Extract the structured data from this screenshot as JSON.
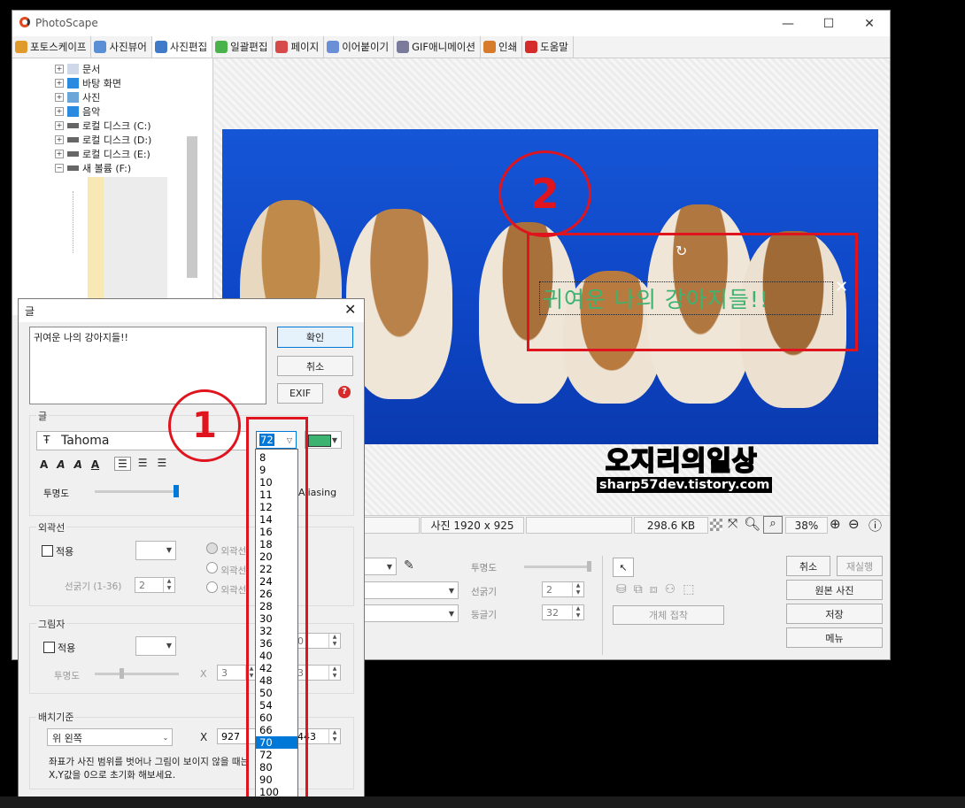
{
  "window": {
    "title": "PhotoScape",
    "controls": [
      "—",
      "☐",
      "✕"
    ]
  },
  "tabs": [
    {
      "label": "포토스케이프",
      "color": "#e09a2b"
    },
    {
      "label": "사진뷰어",
      "color": "#5a8fd6"
    },
    {
      "label": "사진편집",
      "color": "#3f7bc8",
      "active": true
    },
    {
      "label": "일괄편집",
      "color": "#4ab24a"
    },
    {
      "label": "페이지",
      "color": "#d64a4a"
    },
    {
      "label": "이어붙이기",
      "color": "#6a8fd6"
    },
    {
      "label": "GIF애니메이션",
      "color": "#7a7a9a"
    },
    {
      "label": "인쇄",
      "color": "#d67a2b"
    },
    {
      "label": "도움말",
      "color": "#d62b2b"
    }
  ],
  "tree": [
    {
      "label": "문서",
      "icon": "document-icon"
    },
    {
      "label": "바탕 화면",
      "icon": "desktop-icon"
    },
    {
      "label": "사진",
      "icon": "pictures-icon"
    },
    {
      "label": "음악",
      "icon": "music-icon"
    },
    {
      "label": "로컬 디스크 (C:)",
      "icon": "drive-icon"
    },
    {
      "label": "로컬 디스크 (D:)",
      "icon": "drive-icon"
    },
    {
      "label": "로컬 디스크 (E:)",
      "icon": "drive-icon"
    },
    {
      "label": "새 볼륨 (F:)",
      "icon": "drive-icon"
    }
  ],
  "canvas": {
    "overlay_text": "귀여운 나의 강아지들!!",
    "watermark_main": "오지리의일상",
    "watermark_sub": "sharp57dev.tistory.com"
  },
  "status": {
    "size": "사진 1920 x 925",
    "filesize": "298.6 KB",
    "zoom": "38%"
  },
  "bottom_panel": {
    "opacity_label": "투명도",
    "line_label": "선굵기",
    "line_value": "2",
    "round_label": "둥글기",
    "round_value": "32",
    "object_touch": "개체 접착",
    "cancel": "취소",
    "redo": "재실행",
    "original": "원본 사진",
    "save": "저장",
    "menu": "메뉴"
  },
  "dialog": {
    "title": "글",
    "text_value": "귀여운 나의 강아지들!!",
    "ok": "확인",
    "cancel": "취소",
    "exif": "EXIF",
    "group_text": "글",
    "font": "Tahoma",
    "font_size": "72",
    "color": "#3cb371",
    "style_buttons": [
      "A",
      "A",
      "A",
      "A"
    ],
    "opacity_label": "투명도",
    "antialias_fragment": "Aliasing",
    "group_outline": "외곽선",
    "apply": "적용",
    "outline_options": [
      "외곽선",
      "외곽선",
      "외곽선"
    ],
    "line_width_label": "선굵기 (1-36)",
    "line_width_value": "2",
    "group_shadow": "그림자",
    "shadow_opacity": "투명도",
    "x_label": "X",
    "shadow_x": "3",
    "shadow_y": "3",
    "group_position": "배치기준",
    "position_value": "위 왼쪽",
    "pos_x": "927",
    "pos_y": "443",
    "hint_line1": "좌표가 사진 범위를 벗어나 그림이 보이지 않을 때는",
    "hint_line2": "X,Y값을 0으로 초기화 해보세요."
  },
  "font_size_options": [
    "8",
    "9",
    "10",
    "11",
    "12",
    "14",
    "16",
    "18",
    "20",
    "22",
    "24",
    "26",
    "28",
    "30",
    "32",
    "36",
    "40",
    "42",
    "48",
    "50",
    "54",
    "60",
    "66",
    "70",
    "72",
    "80",
    "90",
    "100"
  ],
  "font_size_selected": "70",
  "annotations": {
    "step1": "1",
    "step2": "2",
    "color": "#e0141e"
  }
}
